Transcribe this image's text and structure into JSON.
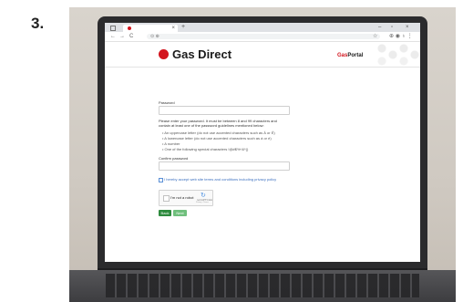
{
  "step_label": "3.",
  "browser": {
    "new_tab": "+",
    "tab_close": "×",
    "window_controls": {
      "minimize": "–",
      "maximize": "▫",
      "close": "×"
    },
    "toolbar": {
      "back": "←",
      "forward": "→",
      "reload": "C",
      "omnibox_icons": "⊙ ⊕",
      "star": "☆",
      "right_icons": "⊕ ◉ ♁ ⋮"
    }
  },
  "page": {
    "logo_text": "Gas Direct",
    "portal_prefix": "Gas",
    "portal_suffix": "Portal",
    "password_label": "Password",
    "instructions_line1": "Please enter your password. It must be between 8 and 99 characters and",
    "instructions_line2": "contain at least one of the password guidelines mentioned below:",
    "rules": [
      "• An uppercase letter (do not use accented characters such as Á or É)",
      "• A lowercase letter (do not use accented characters such as á or é)",
      "• A number",
      "• One of the following special characters !@#$%^&*()"
    ],
    "confirm_label": "Confirm password",
    "accept_text": "I hereby accept web site terms and conditions including privacy policy",
    "captcha": {
      "label": "I'm not a robot",
      "brand": "reCAPTCHA",
      "links": "Privacy - Terms"
    },
    "buttons": {
      "back": "Back",
      "next": "Next"
    }
  },
  "colors": {
    "brand_red": "#d3141d",
    "button_green": "#2e8b3e",
    "button_green_light": "#6fbf7c",
    "link_blue": "#3b6fbf"
  }
}
